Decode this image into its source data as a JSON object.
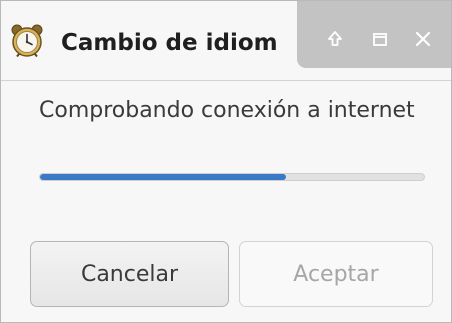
{
  "window": {
    "title": "Cambio de idiom",
    "app_icon": "alarm-clock-icon",
    "controls": {
      "up_icon": "arrow-up-icon",
      "maximize_icon": "maximize-icon",
      "close_icon": "close-icon"
    }
  },
  "dialog": {
    "message": "Comprobando conexión a internet",
    "progress": 0.64,
    "progress_color": "#3a79c7"
  },
  "buttons": {
    "cancel_label": "Cancelar",
    "accept_label": "Aceptar",
    "accept_enabled": false
  }
}
